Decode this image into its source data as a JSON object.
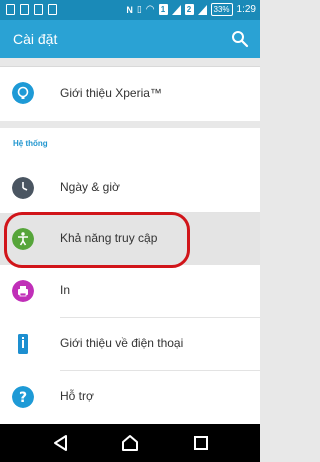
{
  "status_bar": {
    "time": "1:29",
    "battery": "33%",
    "sim1": "1",
    "sim2": "2"
  },
  "app_bar": {
    "title": "Cài đặt"
  },
  "items": {
    "xperia": {
      "label": "Giới thiệu Xperia™"
    },
    "section_system": "Hệ thống",
    "datetime": {
      "label": "Ngày & giờ"
    },
    "accessibility": {
      "label": "Khả năng truy cập"
    },
    "print": {
      "label": "In"
    },
    "about_phone": {
      "label": "Giới thiệu về điện thoại"
    },
    "support": {
      "label": "Hỗ trợ"
    }
  },
  "colors": {
    "accent": "#2aa2d4",
    "highlight": "#d1151a"
  }
}
